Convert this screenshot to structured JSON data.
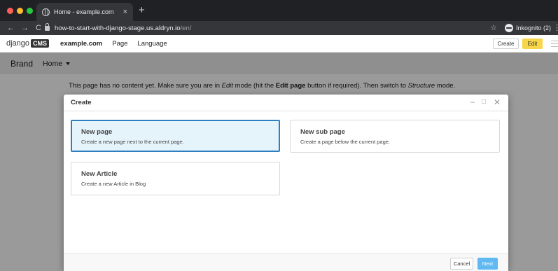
{
  "browser": {
    "tab_title": "Home - example.com",
    "tab_close": "×",
    "new_tab": "+",
    "back": "←",
    "forward": "→",
    "reload": "C",
    "url_host": "how-to-start-with-django-stage.us.aldryn.io",
    "url_path": "/en/",
    "star": "☆",
    "incognito_label": "Inkognito (2)",
    "menu": "⋮"
  },
  "cms_toolbar": {
    "logo_text": "django",
    "logo_box": "CMS",
    "site": "example.com",
    "page": "Page",
    "language": "Language",
    "create_label": "Create",
    "edit_label": "Edit"
  },
  "site_nav": {
    "brand": "Brand",
    "home": "Home"
  },
  "notice": {
    "part1": "This page has no content yet. Make sure you are in ",
    "edit_word": "Edit",
    "part2": " mode (hit the ",
    "edit_page": "Edit page",
    "part3": " button if required). Then switch to ",
    "structure_word": "Structure",
    "part4": " mode."
  },
  "modal": {
    "title": "Create",
    "min": "–",
    "max": "□",
    "close": "✕",
    "options": [
      {
        "title": "New page",
        "description": "Create a new page next to the current page."
      },
      {
        "title": "New sub page",
        "description": "Create a page below the current page."
      },
      {
        "title": "New Article",
        "description": "Create a new Article in Blog"
      }
    ],
    "cancel_label": "Cancel",
    "next_label": "Next"
  }
}
